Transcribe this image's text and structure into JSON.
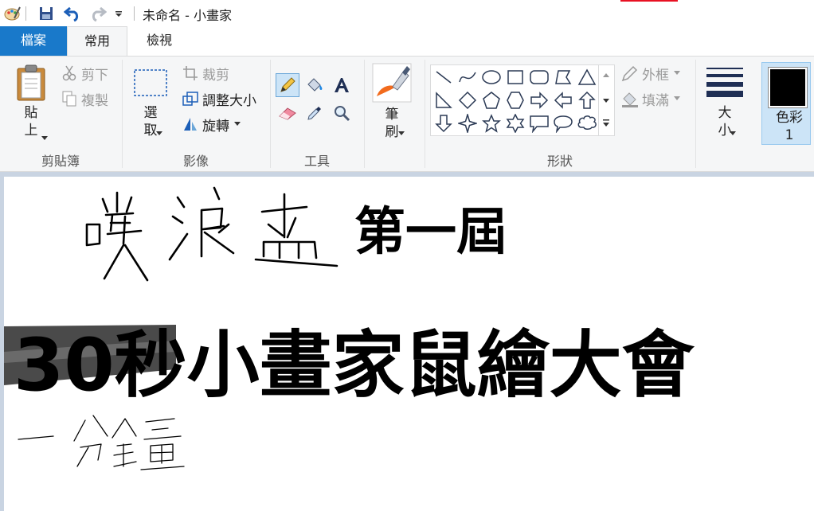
{
  "window": {
    "title": "未命名 - 小畫家"
  },
  "tabs": {
    "file": "檔案",
    "home": "常用",
    "view": "檢視"
  },
  "clipboard": {
    "paste": "貼上",
    "cut": "剪下",
    "copy": "複製",
    "label": "剪貼簿"
  },
  "image": {
    "select": "選取",
    "crop": "裁剪",
    "resize": "調整大小",
    "rotate": "旋轉",
    "label": "影像"
  },
  "tools": {
    "label": "工具"
  },
  "brushes": {
    "label": "筆刷"
  },
  "shapes": {
    "outline": "外框",
    "fill": "填滿",
    "label": "形狀"
  },
  "size": {
    "label": "大小"
  },
  "color1": {
    "label": "色彩 1",
    "value": "#000000"
  },
  "canvas": {
    "edition": "第一屆",
    "headline": "30秒小畫家鼠繪大會"
  },
  "colors": {
    "file_tab": "#1979ca",
    "ribbon": "#f5f6f7",
    "workspace": "#c9d4e2",
    "selected": "#cce4f7"
  }
}
